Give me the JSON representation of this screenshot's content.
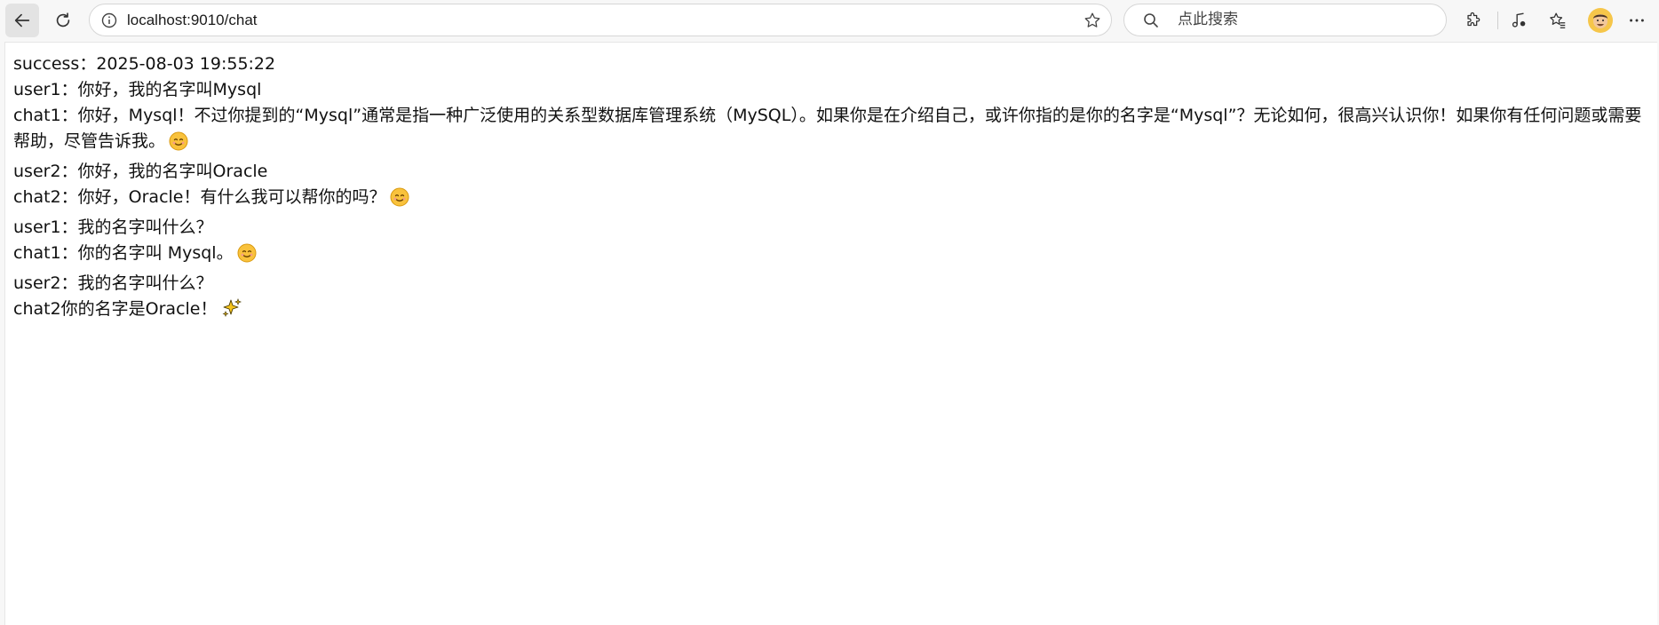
{
  "browser": {
    "url": "localhost:9010/chat",
    "search_placeholder": "点此搜索",
    "icons": {
      "back": "back-arrow-icon",
      "reload": "reload-icon",
      "info": "info-icon",
      "favorite": "star-icon",
      "search": "search-icon",
      "extensions": "puzzle-icon",
      "media": "music-note-icon",
      "favorites": "favorites-icon",
      "profile": "avatar",
      "menu": "more-icon"
    }
  },
  "messages": [
    {
      "text": "success：2025-08-03 19:55:22",
      "emoji": ""
    },
    {
      "text": "user1：你好，我的名字叫Mysql",
      "emoji": ""
    },
    {
      "text": "chat1：你好，Mysql！不过你提到的“Mysql”通常是指一种广泛使用的关系型数据库管理系统（MySQL）。如果你是在介绍自己，或许你指的是你的名字是“Mysql”？无论如何，很高兴认识你！如果你有任何问题或需要帮助，尽管告诉我。",
      "emoji": "smiling-face"
    },
    {
      "text": "user2：你好，我的名字叫Oracle",
      "emoji": ""
    },
    {
      "text": "chat2：你好，Oracle！有什么我可以帮你的吗？",
      "emoji": "smiling-face"
    },
    {
      "text": "user1：我的名字叫什么？",
      "emoji": ""
    },
    {
      "text": "chat1：你的名字叫 Mysql。",
      "emoji": "smiling-face"
    },
    {
      "text": "user2：我的名字叫什么？",
      "emoji": ""
    },
    {
      "text": "chat2你的名字是Oracle！",
      "emoji": "sparkles"
    }
  ]
}
